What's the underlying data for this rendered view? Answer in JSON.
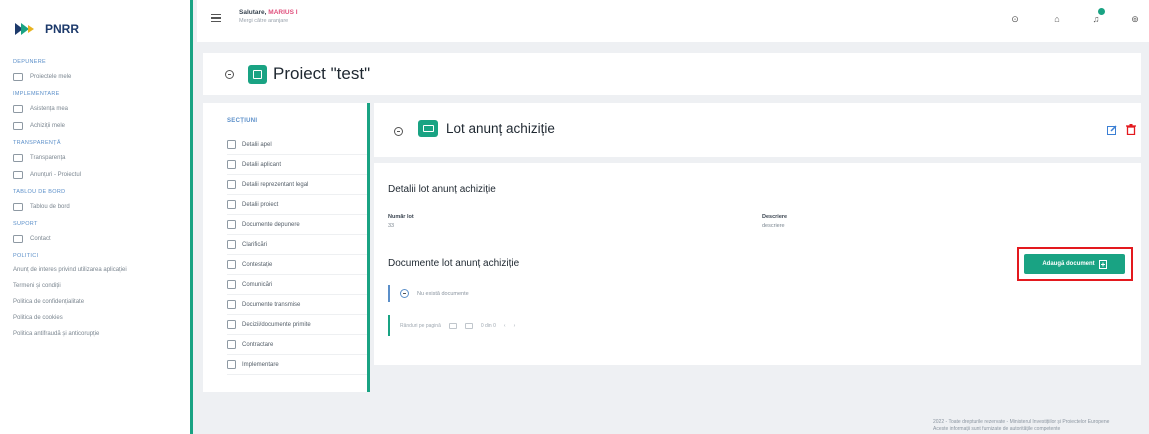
{
  "app": {
    "brand": "PNRR"
  },
  "topbar": {
    "greeting_prefix": "Salutare,",
    "user": "MARIUS I",
    "subline": "Mergi către aranjare"
  },
  "sidebar": {
    "sections": [
      {
        "title": "DEPUNERE",
        "items": [
          {
            "icon": "folder-icon",
            "label": "Proiectele mele"
          }
        ]
      },
      {
        "title": "IMPLEMENTARE",
        "items": [
          {
            "icon": "card-icon",
            "label": "Asistența mea"
          },
          {
            "icon": "doc-icon",
            "label": "Achiziții mele"
          }
        ]
      },
      {
        "title": "TRANSPARENȚĂ",
        "items": [
          {
            "icon": "grid-icon",
            "label": "Transparența"
          },
          {
            "icon": "pin-icon",
            "label": "Anunțuri - Proiectul"
          }
        ]
      },
      {
        "title": "TABLOU DE BORD",
        "items": [
          {
            "icon": "chart-icon",
            "label": "Tablou de bord"
          }
        ]
      },
      {
        "title": "SUPORT",
        "items": [
          {
            "icon": "mail-icon",
            "label": "Contact"
          }
        ]
      },
      {
        "title": "POLITICI",
        "items": []
      }
    ],
    "policies": [
      "Anunț de interes privind utilizarea aplicației",
      "Termeni și condiții",
      "Politica de confidențialitate",
      "Politica de cookies",
      "Politica antifraudă și anticorupție"
    ]
  },
  "project": {
    "title": "Proiect \"test\""
  },
  "sections_panel": {
    "heading": "SECȚIUNI",
    "items": [
      "Detalii apel",
      "Detalii aplicant",
      "Detalii reprezentant legal",
      "Detalii proiect",
      "Documente depunere",
      "Clarificări",
      "Contestație",
      "Comunicări",
      "Documente transmise",
      "Decizii/documente primite",
      "Contractare",
      "Implementare"
    ]
  },
  "lot": {
    "title": "Lot anunț achiziție"
  },
  "details": {
    "heading": "Detalii lot anunț achiziție",
    "nr_label": "Număr lot",
    "nr_value": "33",
    "desc_label": "Descriere",
    "desc_value": "descriere"
  },
  "documents": {
    "heading": "Documente lot anunț achiziție",
    "add_button": "Adaugă document",
    "empty": "Nu există documente",
    "per_page": "Rânduri pe pagină",
    "range": "0 din 0"
  },
  "footer": {
    "line1": "2022 - Toate drepturile rezervate - Ministerul Investițiilor și Proiectelor Europene",
    "line2": "Aceste informații sunt furnizate de autoritățile competente"
  },
  "colors": {
    "accent": "#19a383",
    "highlight": "#e3191e"
  }
}
